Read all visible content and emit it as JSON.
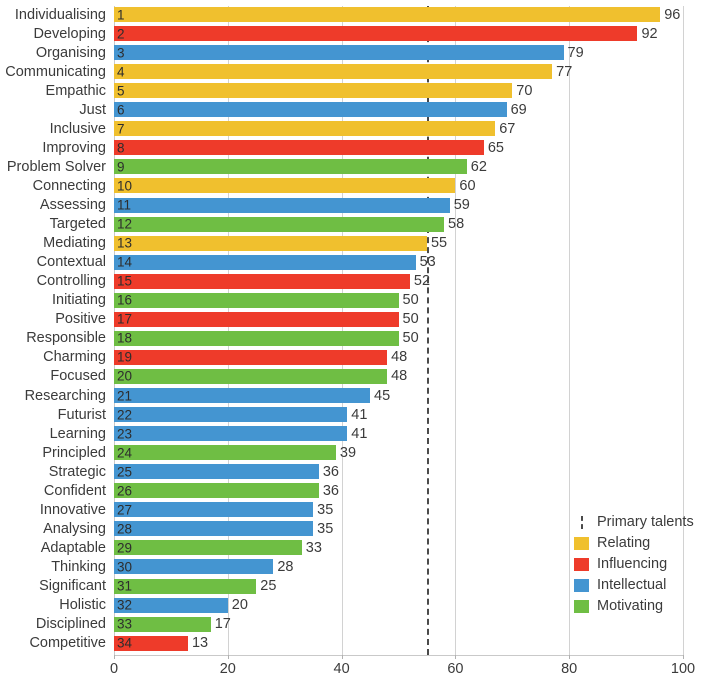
{
  "chart_data": {
    "type": "bar",
    "orientation": "horizontal",
    "title": "",
    "xlabel": "",
    "ylabel": "",
    "xlim": [
      0,
      100
    ],
    "xticks": [
      0,
      20,
      40,
      60,
      80,
      100
    ],
    "xtick_labels": [
      "0",
      "20",
      "40",
      "60",
      "80",
      "100"
    ],
    "grid": "vertical",
    "legend_position": "bottom-right",
    "threshold": {
      "value": 55,
      "label": "Primary talents",
      "style": "dashed",
      "color": "#4a4a4a"
    },
    "group_colors": {
      "Relating": "#f0c02e",
      "Influencing": "#ee3b2a",
      "Intellectual": "#4495d1",
      "Motivating": "#6fbe44"
    },
    "categories": [
      "Individualising",
      "Developing",
      "Organising",
      "Communicating",
      "Empathic",
      "Just",
      "Inclusive",
      "Improving",
      "Problem Solver",
      "Connecting",
      "Assessing",
      "Targeted",
      "Mediating",
      "Contextual",
      "Controlling",
      "Initiating",
      "Positive",
      "Responsible",
      "Charming",
      "Focused",
      "Researching",
      "Futurist",
      "Learning",
      "Principled",
      "Strategic",
      "Confident",
      "Innovative",
      "Analysing",
      "Adaptable",
      "Thinking",
      "Significant",
      "Holistic",
      "Disciplined",
      "Competitive"
    ],
    "values": [
      96,
      92,
      79,
      77,
      70,
      69,
      67,
      65,
      62,
      60,
      59,
      58,
      55,
      53,
      52,
      50,
      50,
      50,
      48,
      48,
      45,
      41,
      41,
      39,
      36,
      36,
      35,
      35,
      33,
      28,
      25,
      20,
      17,
      13
    ],
    "ranks": [
      "1",
      "2",
      "3",
      "4",
      "5",
      "6",
      "7",
      "8",
      "9",
      "10",
      "11",
      "12",
      "13",
      "14",
      "15",
      "16",
      "17",
      "18",
      "19",
      "20",
      "21",
      "22",
      "23",
      "24",
      "25",
      "26",
      "27",
      "28",
      "29",
      "30",
      "31",
      "32",
      "33",
      "34"
    ],
    "groups": [
      "Relating",
      "Influencing",
      "Intellectual",
      "Relating",
      "Relating",
      "Intellectual",
      "Relating",
      "Influencing",
      "Motivating",
      "Relating",
      "Intellectual",
      "Motivating",
      "Relating",
      "Intellectual",
      "Influencing",
      "Motivating",
      "Influencing",
      "Motivating",
      "Influencing",
      "Motivating",
      "Intellectual",
      "Intellectual",
      "Intellectual",
      "Motivating",
      "Intellectual",
      "Motivating",
      "Intellectual",
      "Intellectual",
      "Motivating",
      "Intellectual",
      "Motivating",
      "Intellectual",
      "Motivating",
      "Influencing"
    ]
  },
  "legend": {
    "items": [
      {
        "label": "Primary talents",
        "type": "dashed-line",
        "color": "#4a4a4a"
      },
      {
        "label": "Relating",
        "type": "swatch",
        "color": "#f0c02e"
      },
      {
        "label": "Influencing",
        "type": "swatch",
        "color": "#ee3b2a"
      },
      {
        "label": "Intellectual",
        "type": "swatch",
        "color": "#4495d1"
      },
      {
        "label": "Motivating",
        "type": "swatch",
        "color": "#6fbe44"
      }
    ]
  }
}
